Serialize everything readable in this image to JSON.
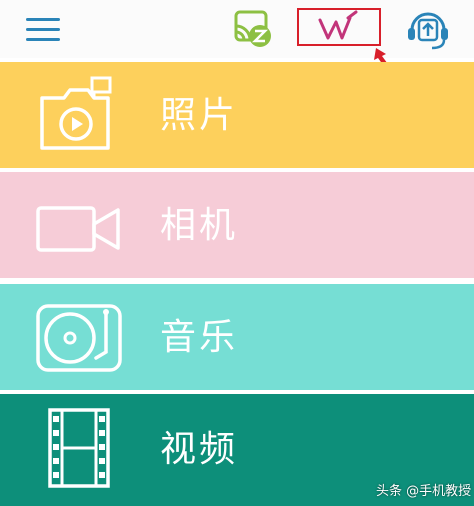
{
  "topbar": {
    "icons": [
      "menu-icon",
      "cast-icon",
      "handwriting-icon",
      "support-icon"
    ]
  },
  "tiles": [
    {
      "label": "照片",
      "icon": "camera-photo-icon",
      "color": "#fdd05c"
    },
    {
      "label": "相机",
      "icon": "video-camera-icon",
      "color": "#f6ccd7"
    },
    {
      "label": "音乐",
      "icon": "turntable-icon",
      "color": "#76ded4"
    },
    {
      "label": "视频",
      "icon": "film-strip-icon",
      "color": "#0d8f7a"
    }
  ],
  "colors": {
    "menu_accent": "#2a84b8",
    "cast_green": "#8dc043",
    "handwriting_pink": "#c2357a",
    "highlight_red": "#d81f2a"
  },
  "watermark": "头条 @手机教授"
}
